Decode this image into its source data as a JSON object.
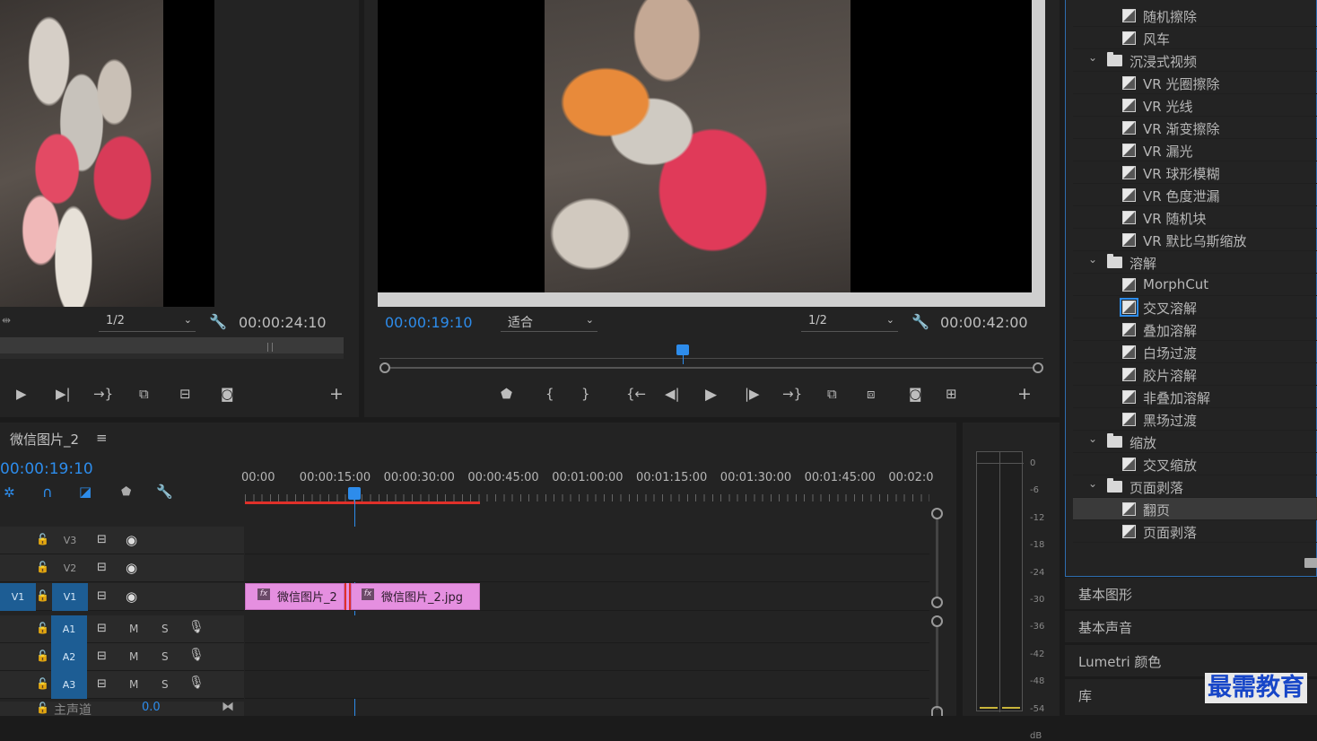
{
  "source_monitor": {
    "zoom": "1/2",
    "duration": "00:00:24:10"
  },
  "program_monitor": {
    "timecode": "00:00:19:10",
    "fit": "适合",
    "zoom": "1/2",
    "duration": "00:00:42:00"
  },
  "timeline": {
    "sequence_name": "微信图片_2",
    "timecode": "00:00:19:10",
    "ruler": [
      "00:00",
      "00:00:15:00",
      "00:00:30:00",
      "00:00:45:00",
      "00:01:00:00",
      "00:01:15:00",
      "00:01:30:00",
      "00:01:45:00",
      "00:02:0"
    ],
    "tracks": [
      {
        "id": "V3",
        "src": "",
        "m": "",
        "s": ""
      },
      {
        "id": "V2",
        "src": "",
        "m": "",
        "s": ""
      },
      {
        "id": "V1",
        "src": "V1",
        "m": "",
        "s": ""
      },
      {
        "id": "A1",
        "src": "",
        "m": "M",
        "s": "S"
      },
      {
        "id": "A2",
        "src": "",
        "m": "M",
        "s": "S"
      },
      {
        "id": "A3",
        "src": "",
        "m": "M",
        "s": "S"
      }
    ],
    "master": {
      "label": "主声道",
      "value": "0.0"
    },
    "clips": [
      {
        "label": "微信图片_2",
        "fx": "fx"
      },
      {
        "label": "微信图片_2.jpg",
        "fx": "fx"
      }
    ]
  },
  "meters": {
    "scale": [
      "0",
      "-6",
      "-12",
      "-18",
      "-24",
      "-30",
      "-36",
      "-42",
      "-48",
      "-54",
      "dB"
    ]
  },
  "effects": {
    "items": [
      {
        "type": "effect",
        "label": "随机擦除"
      },
      {
        "type": "effect",
        "label": "风车"
      },
      {
        "type": "folder",
        "label": "沉浸式视频"
      },
      {
        "type": "effect",
        "label": "VR 光圈擦除"
      },
      {
        "type": "effect",
        "label": "VR 光线"
      },
      {
        "type": "effect",
        "label": "VR 渐变擦除"
      },
      {
        "type": "effect",
        "label": "VR 漏光"
      },
      {
        "type": "effect",
        "label": "VR 球形模糊"
      },
      {
        "type": "effect",
        "label": "VR 色度泄漏"
      },
      {
        "type": "effect",
        "label": "VR 随机块"
      },
      {
        "type": "effect",
        "label": "VR 默比乌斯缩放"
      },
      {
        "type": "folder",
        "label": "溶解"
      },
      {
        "type": "effect",
        "label": "MorphCut"
      },
      {
        "type": "effect",
        "label": "交叉溶解"
      },
      {
        "type": "effect",
        "label": "叠加溶解"
      },
      {
        "type": "effect",
        "label": "白场过渡"
      },
      {
        "type": "effect",
        "label": "胶片溶解"
      },
      {
        "type": "effect",
        "label": "非叠加溶解"
      },
      {
        "type": "effect",
        "label": "黑场过渡"
      },
      {
        "type": "folder",
        "label": "缩放"
      },
      {
        "type": "effect",
        "label": "交叉缩放"
      },
      {
        "type": "folder",
        "label": "页面剥落"
      },
      {
        "type": "effect",
        "label": "翻页"
      },
      {
        "type": "effect",
        "label": "页面剥落"
      }
    ]
  },
  "side_panels": [
    "基本图形",
    "基本声音",
    "Lumetri 颜色",
    "库"
  ],
  "watermark": "最需教育",
  "colors": {
    "accent_blue": "#2d8ceb",
    "clip_pink": "#e58fe0",
    "playhead": "#2d8ceb",
    "work_area_red": "#e0302a"
  }
}
